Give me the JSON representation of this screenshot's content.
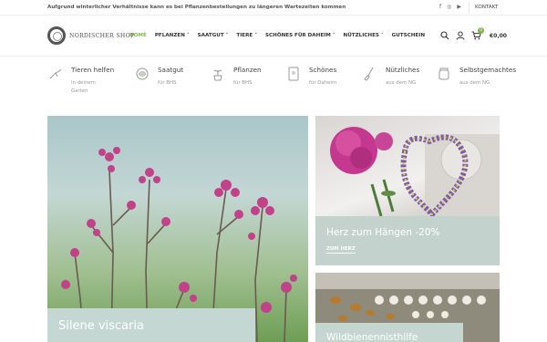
{
  "topbar": {
    "notice": "Aufgrund winterlicher Verhältnisse kann es bei Pflanzenbestellungen zu längeren Wartezeiten kommen",
    "social": [
      {
        "icon": "facebook-icon",
        "glyph": "f"
      },
      {
        "icon": "instagram-icon",
        "glyph": "◎"
      },
      {
        "icon": "youtube-icon",
        "glyph": "▶"
      }
    ],
    "contact": "KONTAKT"
  },
  "header": {
    "logo_text": "NORDISCHER SHOP",
    "nav": [
      {
        "label": "HOME",
        "active": true
      },
      {
        "label": "PFLANZEN ˅",
        "active": false
      },
      {
        "label": "SAATGUT ˅",
        "active": false
      },
      {
        "label": "TIERE ˅",
        "active": false
      },
      {
        "label": "SCHÖNES FÜR DAHEIM ˅",
        "active": false
      },
      {
        "label": "NÜTZLICHES ˅",
        "active": false
      },
      {
        "label": "GUTSCHEIN",
        "active": false
      }
    ],
    "cart_count": "0",
    "cart_total": "€0,00",
    "accent": "#7eb84a"
  },
  "categories": [
    {
      "title": "Tieren helfen",
      "sub1": "in deinem",
      "sub2": "Garten",
      "icon": "bird-icon"
    },
    {
      "title": "Saatgut",
      "sub1": "für BHS",
      "sub2": "",
      "icon": "seed-bowl-icon"
    },
    {
      "title": "Pflanzen",
      "sub1": "für BHS",
      "sub2": "",
      "icon": "potted-plant-icon"
    },
    {
      "title": "Schönes",
      "sub1": "für Daheim",
      "sub2": "",
      "icon": "card-icon"
    },
    {
      "title": "Nützliches",
      "sub1": "aus dem NG",
      "sub2": "",
      "icon": "brush-icon"
    },
    {
      "title": "Selbstgemachtes",
      "sub1": "aus dem NG",
      "sub2": "",
      "icon": "jar-icon"
    }
  ],
  "hero": {
    "title": "Silene viscaria"
  },
  "tile1": {
    "title": "Herz zum Hängen -20%",
    "link": "ZUM HERZ"
  },
  "tile2": {
    "title": "Wildbienennisthilfe"
  }
}
